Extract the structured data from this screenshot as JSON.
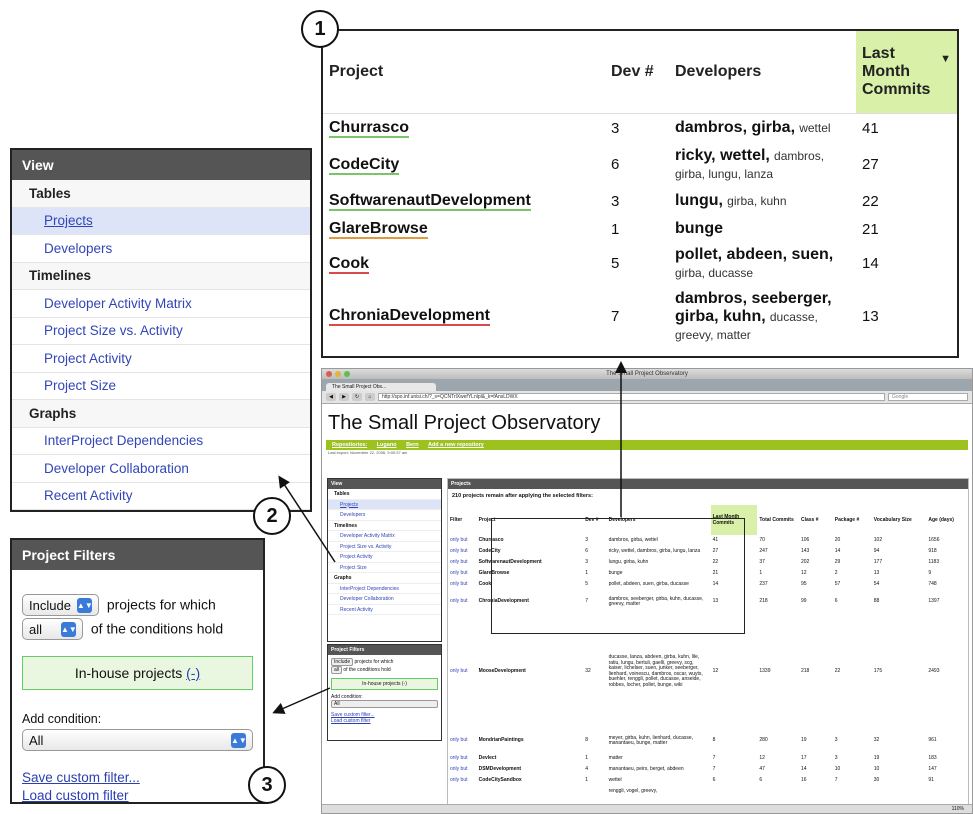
{
  "callouts": [
    "1",
    "2",
    "3"
  ],
  "zoom_table": {
    "columns": [
      "Project",
      "Dev #",
      "Developers",
      "Last Month Commits"
    ],
    "rows": [
      {
        "project": "Churrasco",
        "dev": "3",
        "devs_bold": "dambros, girba,",
        "devs_small": "wettel",
        "commits": "41",
        "underline": "#7cc46a"
      },
      {
        "project": "CodeCity",
        "dev": "6",
        "devs_bold": "ricky, wettel,",
        "devs_small": "dambros, girba, lungu, lanza",
        "commits": "27",
        "underline": "#7cc46a"
      },
      {
        "project": "SoftwarenautDevelopment",
        "dev": "3",
        "devs_bold": "lungu,",
        "devs_small": "girba, kuhn",
        "commits": "22",
        "underline": "#7cc46a"
      },
      {
        "project": "GlareBrowse",
        "dev": "1",
        "devs_bold": "bunge",
        "devs_small": "",
        "commits": "21",
        "underline": "#e09a3c"
      },
      {
        "project": "Cook",
        "dev": "5",
        "devs_bold": "pollet, abdeen, suen,",
        "devs_small": "girba, ducasse",
        "commits": "14",
        "underline": "#d94a4a"
      },
      {
        "project": "ChroniaDevelopment",
        "dev": "7",
        "devs_bold": "dambros, seeberger, girba, kuhn,",
        "devs_small": "ducasse, greevy, matter",
        "commits": "13",
        "underline": "#d94a4a"
      }
    ]
  },
  "view_panel": {
    "header": "View",
    "sections": [
      {
        "title": "Tables",
        "items": [
          "Projects",
          "Developers"
        ]
      },
      {
        "title": "Timelines",
        "items": [
          "Developer Activity Matrix",
          "Project Size vs. Activity",
          "Project Activity",
          "Project Size"
        ]
      },
      {
        "title": "Graphs",
        "items": [
          "InterProject Dependencies",
          "Developer Collaboration",
          "Recent Activity"
        ]
      }
    ],
    "active_item": "Projects"
  },
  "filters": {
    "header": "Project Filters",
    "include_value": "Include",
    "text1": "projects for which",
    "all_value": "all",
    "text2": "of the conditions hold",
    "inhouse": "In-house projects",
    "inhouse_link": "(-)",
    "add_condition_label": "Add condition:",
    "add_condition_value": "All",
    "save_link": "Save custom filter...",
    "load_link": "Load custom filter"
  },
  "browser": {
    "window_title": "The Small Project Observatory",
    "tab_title": "The Small Project Obs...",
    "url": "http://spo.inf.unisi.ch/?_s=QCNTrlXwefYLnlpl&_k=fAnsLDWX",
    "search_placeholder": "Google",
    "page_title": "The Small Project Observatory",
    "nav": {
      "repositories": "Repositories:",
      "lugano": "Lugano",
      "bern": "Bern",
      "add": "Add a new repository"
    },
    "last_import": "Last import: November 22, 2006, 9:00:37 am",
    "main_header": "Projects",
    "remain_text": "210 projects remain after applying the selected filters:",
    "filter_link": "only but",
    "columns": [
      "Filter",
      "Project",
      "Dev #",
      "Developers",
      "Last Month Commits",
      "Total Commits",
      "Class #",
      "Package #",
      "Vocabulary Size",
      "Age (days)"
    ],
    "rows": [
      {
        "project": "Churrasco",
        "dev": "3",
        "devs": "dambros, girba, wettel",
        "last": "41",
        "total": "70",
        "cls": "106",
        "pkg": "20",
        "voc": "102",
        "age": "1656",
        "h": "r1"
      },
      {
        "project": "CodeCity",
        "dev": "6",
        "devs": "ricky, wettel, dambros, girba, lungu, lanza",
        "last": "27",
        "total": "247",
        "cls": "143",
        "pkg": "14",
        "voc": "94",
        "age": "918",
        "h": "r1"
      },
      {
        "project": "SoftwarenautDevelopment",
        "dev": "3",
        "devs": "lungu, girba, kuhn",
        "last": "22",
        "total": "37",
        "cls": "202",
        "pkg": "29",
        "voc": "177",
        "age": "1183",
        "h": "r1"
      },
      {
        "project": "GlareBrowse",
        "dev": "1",
        "devs": "bunge",
        "last": "21",
        "total": "1",
        "cls": "12",
        "pkg": "2",
        "voc": "13",
        "age": "9",
        "h": "r1"
      },
      {
        "project": "Cook",
        "dev": "5",
        "devs": "pollet, abdeen, suen, girba, ducasse",
        "last": "14",
        "total": "237",
        "cls": "95",
        "pkg": "57",
        "voc": "54",
        "age": "748",
        "h": "r1"
      },
      {
        "project": "ChroniaDevelopment",
        "dev": "7",
        "devs": "dambros, seeberger, girba, kuhn, ducasse, greevy, matter",
        "last": "13",
        "total": "218",
        "cls": "99",
        "pkg": "6",
        "voc": "88",
        "age": "1397",
        "h": "rmid"
      },
      {
        "project": "MooseDevelopment",
        "dev": "32",
        "devs": "ducasse, lanza, abdeen, girba, kuhn, lile, ratiu, lungu, bertuli, gaelli, greevy, scg, kaiser, lichelser, suen, junker, seeberger, lienhard, voinescu, dambros, oscar, wuyts, buehler, renggli, pollet, ducasse, anseide, robbes, locher, pollet, bunge, wiki",
        "last": "12",
        "total": "1339",
        "cls": "218",
        "pkg": "22",
        "voc": "175",
        "age": "2493",
        "h": "rbig"
      },
      {
        "project": "MondrianPaintings",
        "dev": "8",
        "devs": "meyer, girba, kuhn, lienhard, ducasse, manantaeu, bunge, matter",
        "last": "8",
        "total": "280",
        "cls": "19",
        "pkg": "3",
        "voc": "32",
        "age": "961",
        "h": "rmid"
      },
      {
        "project": "Devlect",
        "dev": "1",
        "devs": "matter",
        "last": "7",
        "total": "12",
        "cls": "17",
        "pkg": "3",
        "voc": "19",
        "age": "183",
        "h": "rsm"
      },
      {
        "project": "DSMDevelopment",
        "dev": "4",
        "devs": "manantaeu, peirs, berget, abdeen",
        "last": "7",
        "total": "47",
        "cls": "14",
        "pkg": "10",
        "voc": "10",
        "age": "147",
        "h": "rsm"
      },
      {
        "project": "CodeCitySandbox",
        "dev": "1",
        "devs": "wettel",
        "last": "6",
        "total": "6",
        "cls": "16",
        "pkg": "7",
        "voc": "30",
        "age": "91",
        "h": "rsm"
      },
      {
        "project": "",
        "dev": "",
        "devs": "renggli, vogel, greevy,",
        "last": "",
        "total": "",
        "cls": "",
        "pkg": "",
        "voc": "",
        "age": "",
        "h": "rsm"
      }
    ],
    "zoom": "110%"
  }
}
